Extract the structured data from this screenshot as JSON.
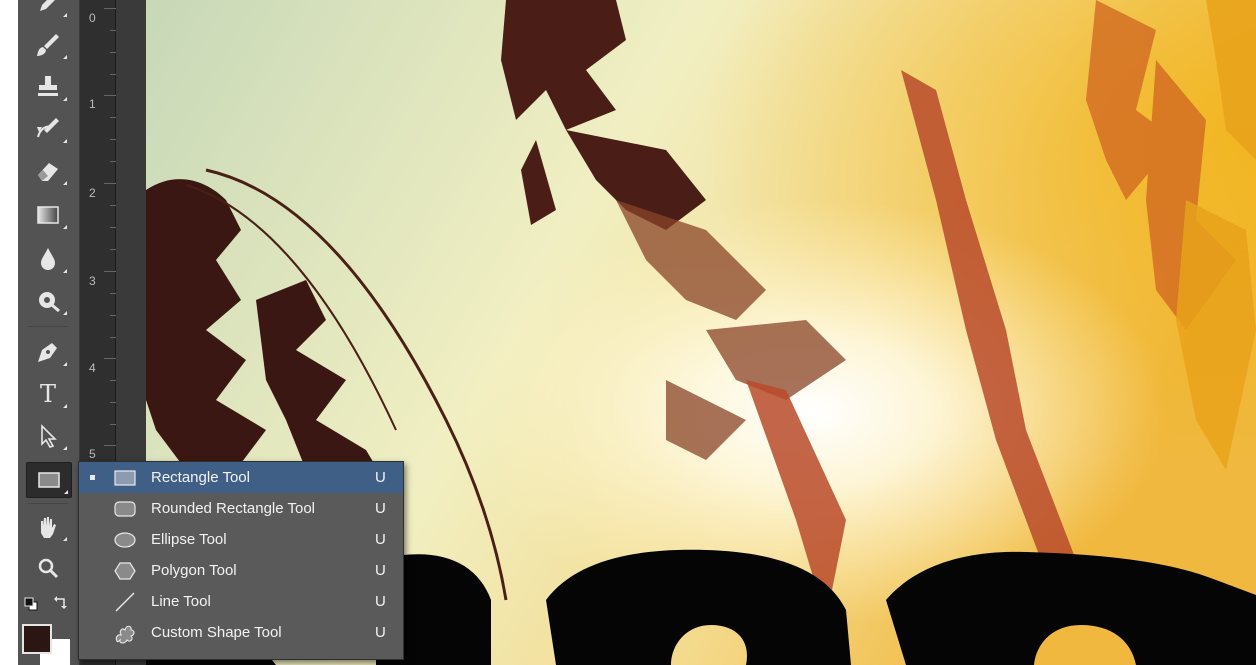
{
  "toolbar": {
    "tools": [
      {
        "name": "pencil-icon"
      },
      {
        "name": "brush-icon"
      },
      {
        "name": "clone-stamp-icon"
      },
      {
        "name": "history-brush-icon"
      },
      {
        "name": "eraser-icon"
      },
      {
        "name": "gradient-icon"
      },
      {
        "name": "blur-drop-icon"
      },
      {
        "name": "dodge-icon"
      },
      {
        "name": "pen-icon"
      },
      {
        "name": "type-icon"
      },
      {
        "name": "path-selection-icon"
      },
      {
        "name": "rectangle-shape-icon",
        "active": true
      },
      {
        "name": "hand-icon"
      },
      {
        "name": "zoom-icon"
      }
    ],
    "type_glyph": "T",
    "foreground_color": "#2b1614",
    "background_color": "#ffffff"
  },
  "ruler": {
    "labels": [
      "0",
      "1",
      "2",
      "3",
      "4",
      "5"
    ]
  },
  "flyout": {
    "items": [
      {
        "label": "Rectangle Tool",
        "shortcut": "U",
        "icon": "rectangle-icon",
        "selected": true
      },
      {
        "label": "Rounded Rectangle Tool",
        "shortcut": "U",
        "icon": "rounded-rectangle-icon",
        "selected": false
      },
      {
        "label": "Ellipse Tool",
        "shortcut": "U",
        "icon": "ellipse-icon",
        "selected": false
      },
      {
        "label": "Polygon Tool",
        "shortcut": "U",
        "icon": "polygon-icon",
        "selected": false
      },
      {
        "label": "Line Tool",
        "shortcut": "U",
        "icon": "line-icon",
        "selected": false
      },
      {
        "label": "Custom Shape Tool",
        "shortcut": "U",
        "icon": "custom-shape-icon",
        "selected": false
      }
    ]
  },
  "colors": {
    "panel": "#535353",
    "selection": "#3f5f86",
    "flyout_bg": "#5a5a5a"
  }
}
